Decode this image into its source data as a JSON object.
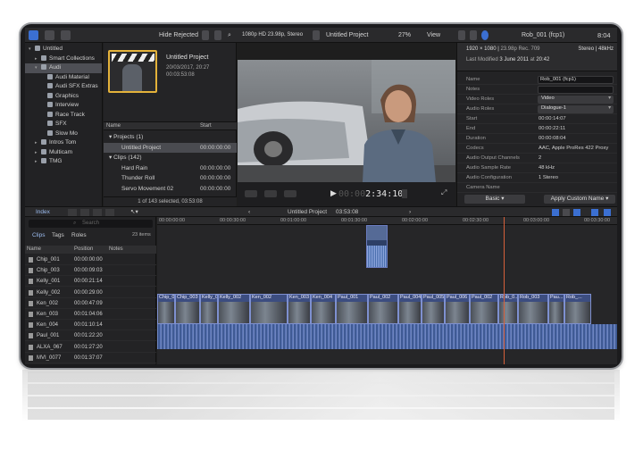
{
  "toolbar": {
    "filter": "Hide Rejected",
    "format": "1080p HD 23.98p, Stereo",
    "project": "Untitled Project",
    "zoom": "27%",
    "view": "View",
    "clip_name": "Rob_001 (fcp1)",
    "duration": "8:04"
  },
  "libraries": [
    {
      "label": "Untitled",
      "indent": 0,
      "tri": "▾",
      "sel": false
    },
    {
      "label": "Smart Collections",
      "indent": 1,
      "tri": "▸",
      "sel": false
    },
    {
      "label": "Audi",
      "indent": 1,
      "tri": "▾",
      "sel": true
    },
    {
      "label": "Audi Material",
      "indent": 2,
      "tri": "",
      "sel": false
    },
    {
      "label": "Audi SFX Extras",
      "indent": 2,
      "tri": "",
      "sel": false
    },
    {
      "label": "Graphics",
      "indent": 2,
      "tri": "",
      "sel": false
    },
    {
      "label": "Interview",
      "indent": 2,
      "tri": "",
      "sel": false
    },
    {
      "label": "Race Track",
      "indent": 2,
      "tri": "",
      "sel": false
    },
    {
      "label": "SFX",
      "indent": 2,
      "tri": "",
      "sel": false
    },
    {
      "label": "Slow Mo",
      "indent": 2,
      "tri": "",
      "sel": false
    },
    {
      "label": "Intros Tom",
      "indent": 1,
      "tri": "▸",
      "sel": false
    },
    {
      "label": "Multicam",
      "indent": 1,
      "tri": "▸",
      "sel": false
    },
    {
      "label": "TMG",
      "indent": 1,
      "tri": "▸",
      "sel": false
    }
  ],
  "browser": {
    "project_title": "Untitled Project",
    "project_date": "20/03/2017, 20:27",
    "project_duration": "00:03:53:08",
    "col_name": "Name",
    "col_start": "Start",
    "rows": [
      {
        "label": "▾ Projects  (1)",
        "start": "",
        "sel": false
      },
      {
        "label": "Untitled Project",
        "start": "00:00:00:00",
        "sel": true
      },
      {
        "label": "▾ Clips  (142)",
        "start": "",
        "sel": false
      },
      {
        "label": "Hard Rain",
        "start": "00:00:00:00",
        "sel": false
      },
      {
        "label": "Thunder Roll",
        "start": "00:00:00:00",
        "sel": false
      },
      {
        "label": "Servo Movement 02",
        "start": "00:00:00:00",
        "sel": false
      }
    ],
    "footer": "1 of 143 selected, 03:53:08"
  },
  "viewer": {
    "timecode_dim": "00:00",
    "timecode": "2:34:10"
  },
  "inspector": {
    "resolution": "1920 × 1080",
    "resolution_detail": "23.98p  Rec. 709",
    "audio": "Stereo | 48kHz",
    "modified_label": "Last Modified",
    "modified": "3 June 2011",
    "modified_at": "at",
    "modified_time": "20:42",
    "rows": [
      {
        "label": "Name",
        "value": "Rob_001 (fcp1)",
        "kind": "field"
      },
      {
        "label": "Notes",
        "value": "",
        "kind": "field"
      },
      {
        "label": "Video Roles",
        "value": "Video",
        "kind": "pop"
      },
      {
        "label": "Audio Roles",
        "value": "Dialogue-1",
        "kind": "pop"
      },
      {
        "label": "Start",
        "value": "00:00:14:07",
        "kind": "text"
      },
      {
        "label": "End",
        "value": "00:00:22:11",
        "kind": "text"
      },
      {
        "label": "Duration",
        "value": "00:00:08:04",
        "kind": "text"
      },
      {
        "label": "Codecs",
        "value": "AAC, Apple ProRes 422 Proxy",
        "kind": "text"
      },
      {
        "label": "Audio Output Channels",
        "value": "2",
        "kind": "text"
      },
      {
        "label": "Audio Sample Rate",
        "value": "48 kHz",
        "kind": "text"
      },
      {
        "label": "Audio Configuration",
        "value": "1 Stereo",
        "kind": "text"
      },
      {
        "label": "Camera Name",
        "value": "",
        "kind": "text"
      }
    ],
    "basic_button": "Basic",
    "custom_button": "Apply Custom Name"
  },
  "timeline_bar": {
    "index_label": "Index",
    "project": "Untitled Project",
    "duration": "03:53:08"
  },
  "index": {
    "search_placeholder": "Search",
    "tab_clips": "Clips",
    "tab_tags": "Tags",
    "tab_roles": "Roles",
    "count": "23 items",
    "col_name": "Name",
    "col_position": "Position",
    "col_notes": "Notes",
    "rows": [
      {
        "name": "Chip_001",
        "position": "00:00:00:00"
      },
      {
        "name": "Chip_003",
        "position": "00:00:09:03"
      },
      {
        "name": "Kelly_001",
        "position": "00:00:21:14"
      },
      {
        "name": "Kelly_002",
        "position": "00:00:29:00"
      },
      {
        "name": "Ken_002",
        "position": "00:00:47:09"
      },
      {
        "name": "Ken_003",
        "position": "00:01:04:06"
      },
      {
        "name": "Ken_004",
        "position": "00:01:10:14"
      },
      {
        "name": "Paul_001",
        "position": "00:01:22:20"
      },
      {
        "name": "ALXA_067",
        "position": "00:01:27:20"
      },
      {
        "name": "MVI_0077",
        "position": "00:01:37:07"
      }
    ]
  },
  "ruler": [
    "00:00:00:00",
    "00:00:30:00",
    "00:01:00:00",
    "00:01:30:00",
    "00:02:00:00",
    "00:02:30:00",
    "00:03:00:00",
    "00:03:30:00"
  ],
  "clips": [
    "Chip_001",
    "Chip_003",
    "Kelly_0...",
    "Kelly_002",
    "Ken_002",
    "Ken_003",
    "Ken_004",
    "Paul_001",
    "Paul_002",
    "Paul_004",
    "Paul_005",
    "Paul_006",
    "Paul_002",
    "Rob_0...",
    "Rob_003",
    "Pau...",
    "Rob_..."
  ],
  "colors": {
    "accent_blue": "#3b6fd1",
    "clip_blue": "#6a7cc0",
    "audio_blue": "#4a6fae",
    "playhead": "#d6603b",
    "selection_yellow": "#e4b23a"
  }
}
